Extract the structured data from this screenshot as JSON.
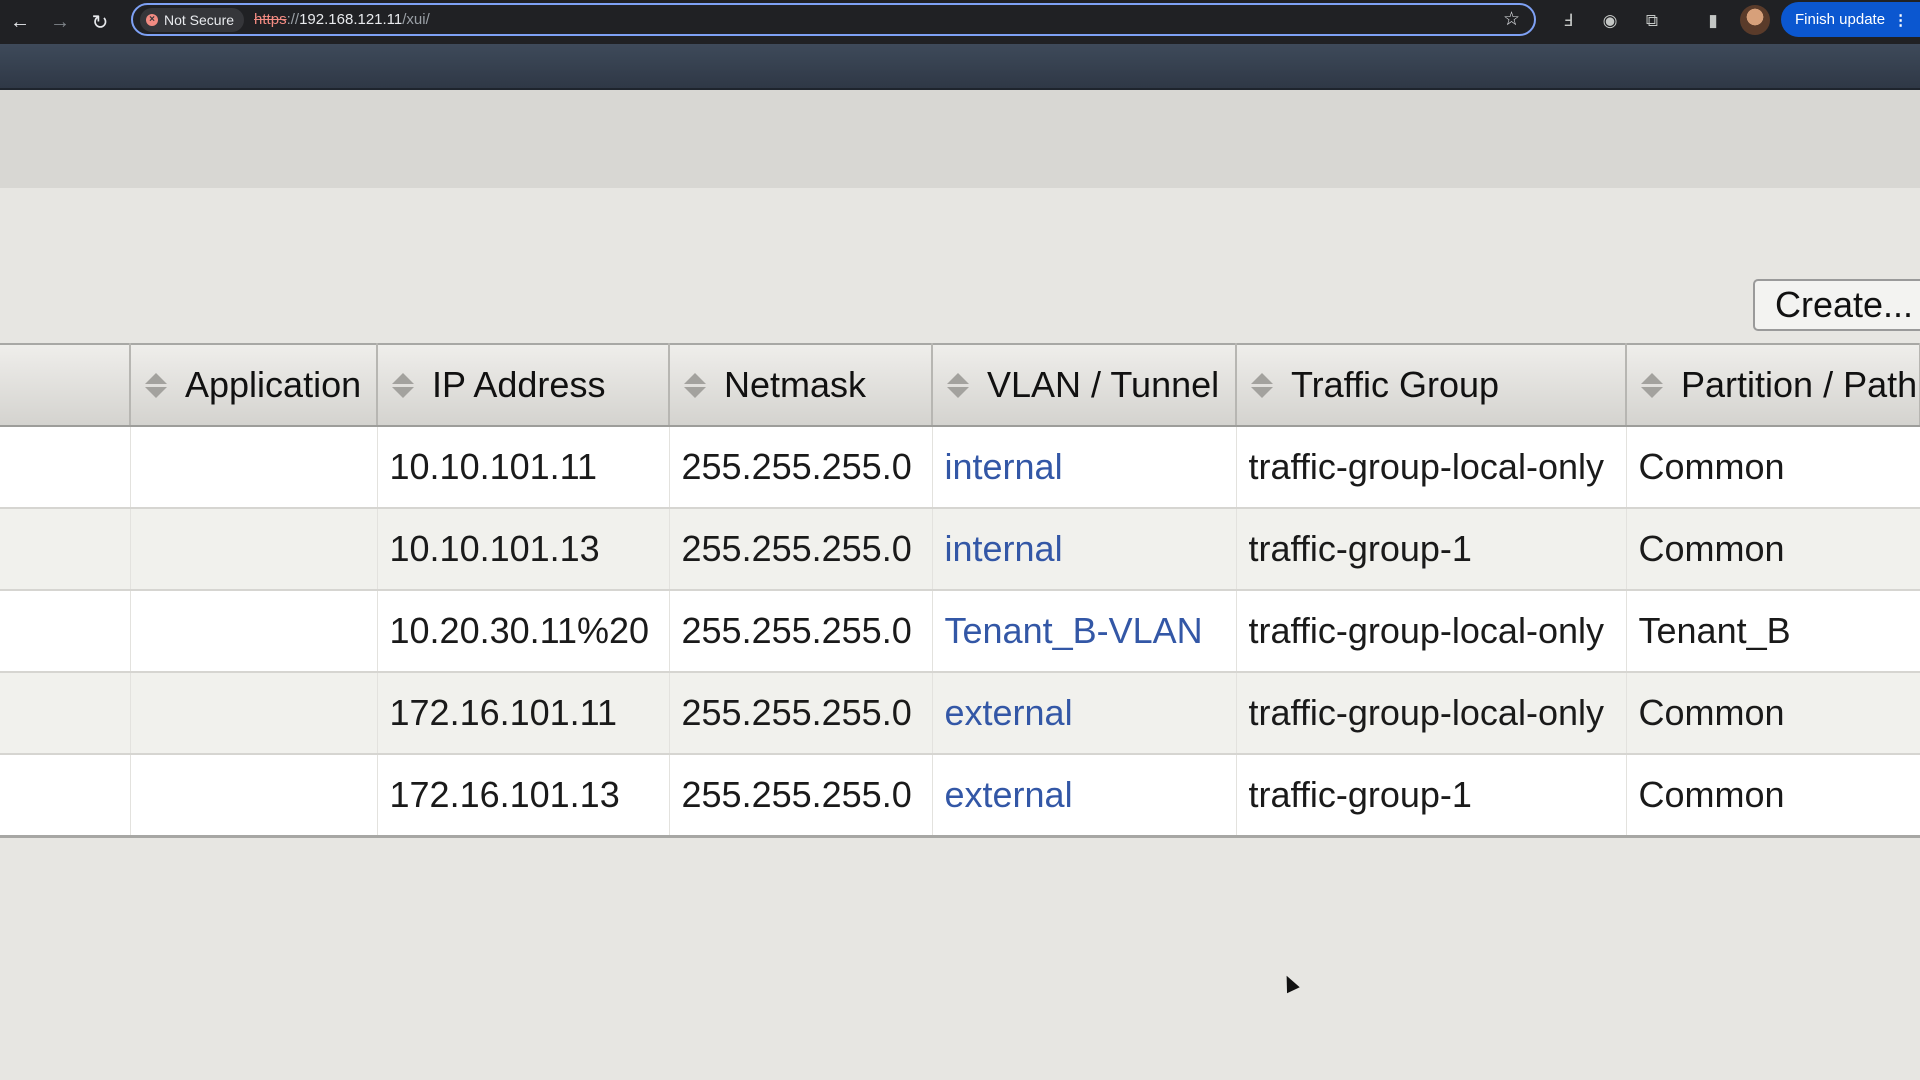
{
  "browser": {
    "security_label": "Not Secure",
    "url_scheme": "https",
    "url_sep": "://",
    "url_host": "192.168.121.11",
    "url_path": "/xui/",
    "finish_update_label": "Finish update",
    "menu_dots": "⋮"
  },
  "toolbar": {
    "create_label": "Create..."
  },
  "table": {
    "columns": [
      "Application",
      "IP Address",
      "Netmask",
      "VLAN / Tunnel",
      "Traffic Group",
      "Partition / Path"
    ],
    "rows": [
      {
        "application": "",
        "ip": "10.10.101.11",
        "netmask": "255.255.255.0",
        "vlan": "internal",
        "traffic_group": "traffic-group-local-only",
        "partition": "Common"
      },
      {
        "application": "",
        "ip": "10.10.101.13",
        "netmask": "255.255.255.0",
        "vlan": "internal",
        "traffic_group": "traffic-group-1",
        "partition": "Common"
      },
      {
        "application": "",
        "ip": "10.20.30.11%20",
        "netmask": "255.255.255.0",
        "vlan": "Tenant_B-VLAN",
        "traffic_group": "traffic-group-local-only",
        "partition": "Tenant_B"
      },
      {
        "application": "",
        "ip": "172.16.101.11",
        "netmask": "255.255.255.0",
        "vlan": "external",
        "traffic_group": "traffic-group-local-only",
        "partition": "Common"
      },
      {
        "application": "",
        "ip": "172.16.101.13",
        "netmask": "255.255.255.0",
        "vlan": "external",
        "traffic_group": "traffic-group-1",
        "partition": "Common"
      }
    ]
  },
  "colors": {
    "link": "#3357a6",
    "banner": "#3e4a5a",
    "accent": "#0b57d0"
  }
}
